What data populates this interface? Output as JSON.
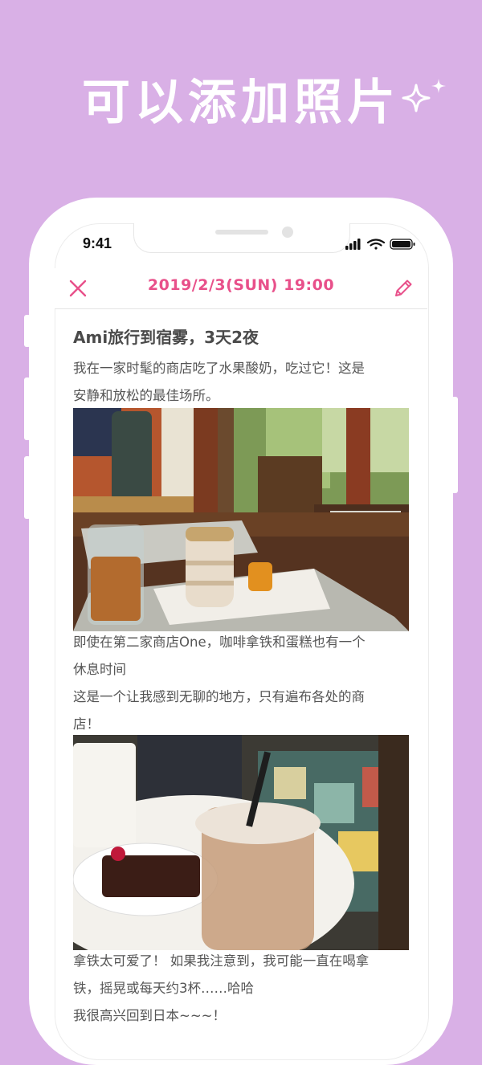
{
  "headline": "可以添加照片",
  "status_bar": {
    "time": "9:41"
  },
  "header": {
    "title": "2019/2/3(SUN) 19:00",
    "close_icon": "close-icon",
    "edit_icon": "pencil-icon"
  },
  "entry": {
    "title": "Ami旅行到宿雾，3天2夜",
    "paragraph1": "我在一家时髦的商店吃了水果酸奶，吃过它！这是\n安静和放松的最佳场所。",
    "paragraph2": "即使在第二家商店One，咖啡拿铁和蛋糕也有一个\n休息时间\n这是一个让我感到无聊的地方，只有遍布各处的商\n店！",
    "paragraph3": "拿铁太可爱了！ 如果我注意到，我可能一直在喝拿\n铁，摇晃或每天约3杯……哈哈\n我很高兴回到日本~~~！"
  },
  "colors": {
    "background": "#d9b0e6",
    "accent": "#e8508a"
  }
}
